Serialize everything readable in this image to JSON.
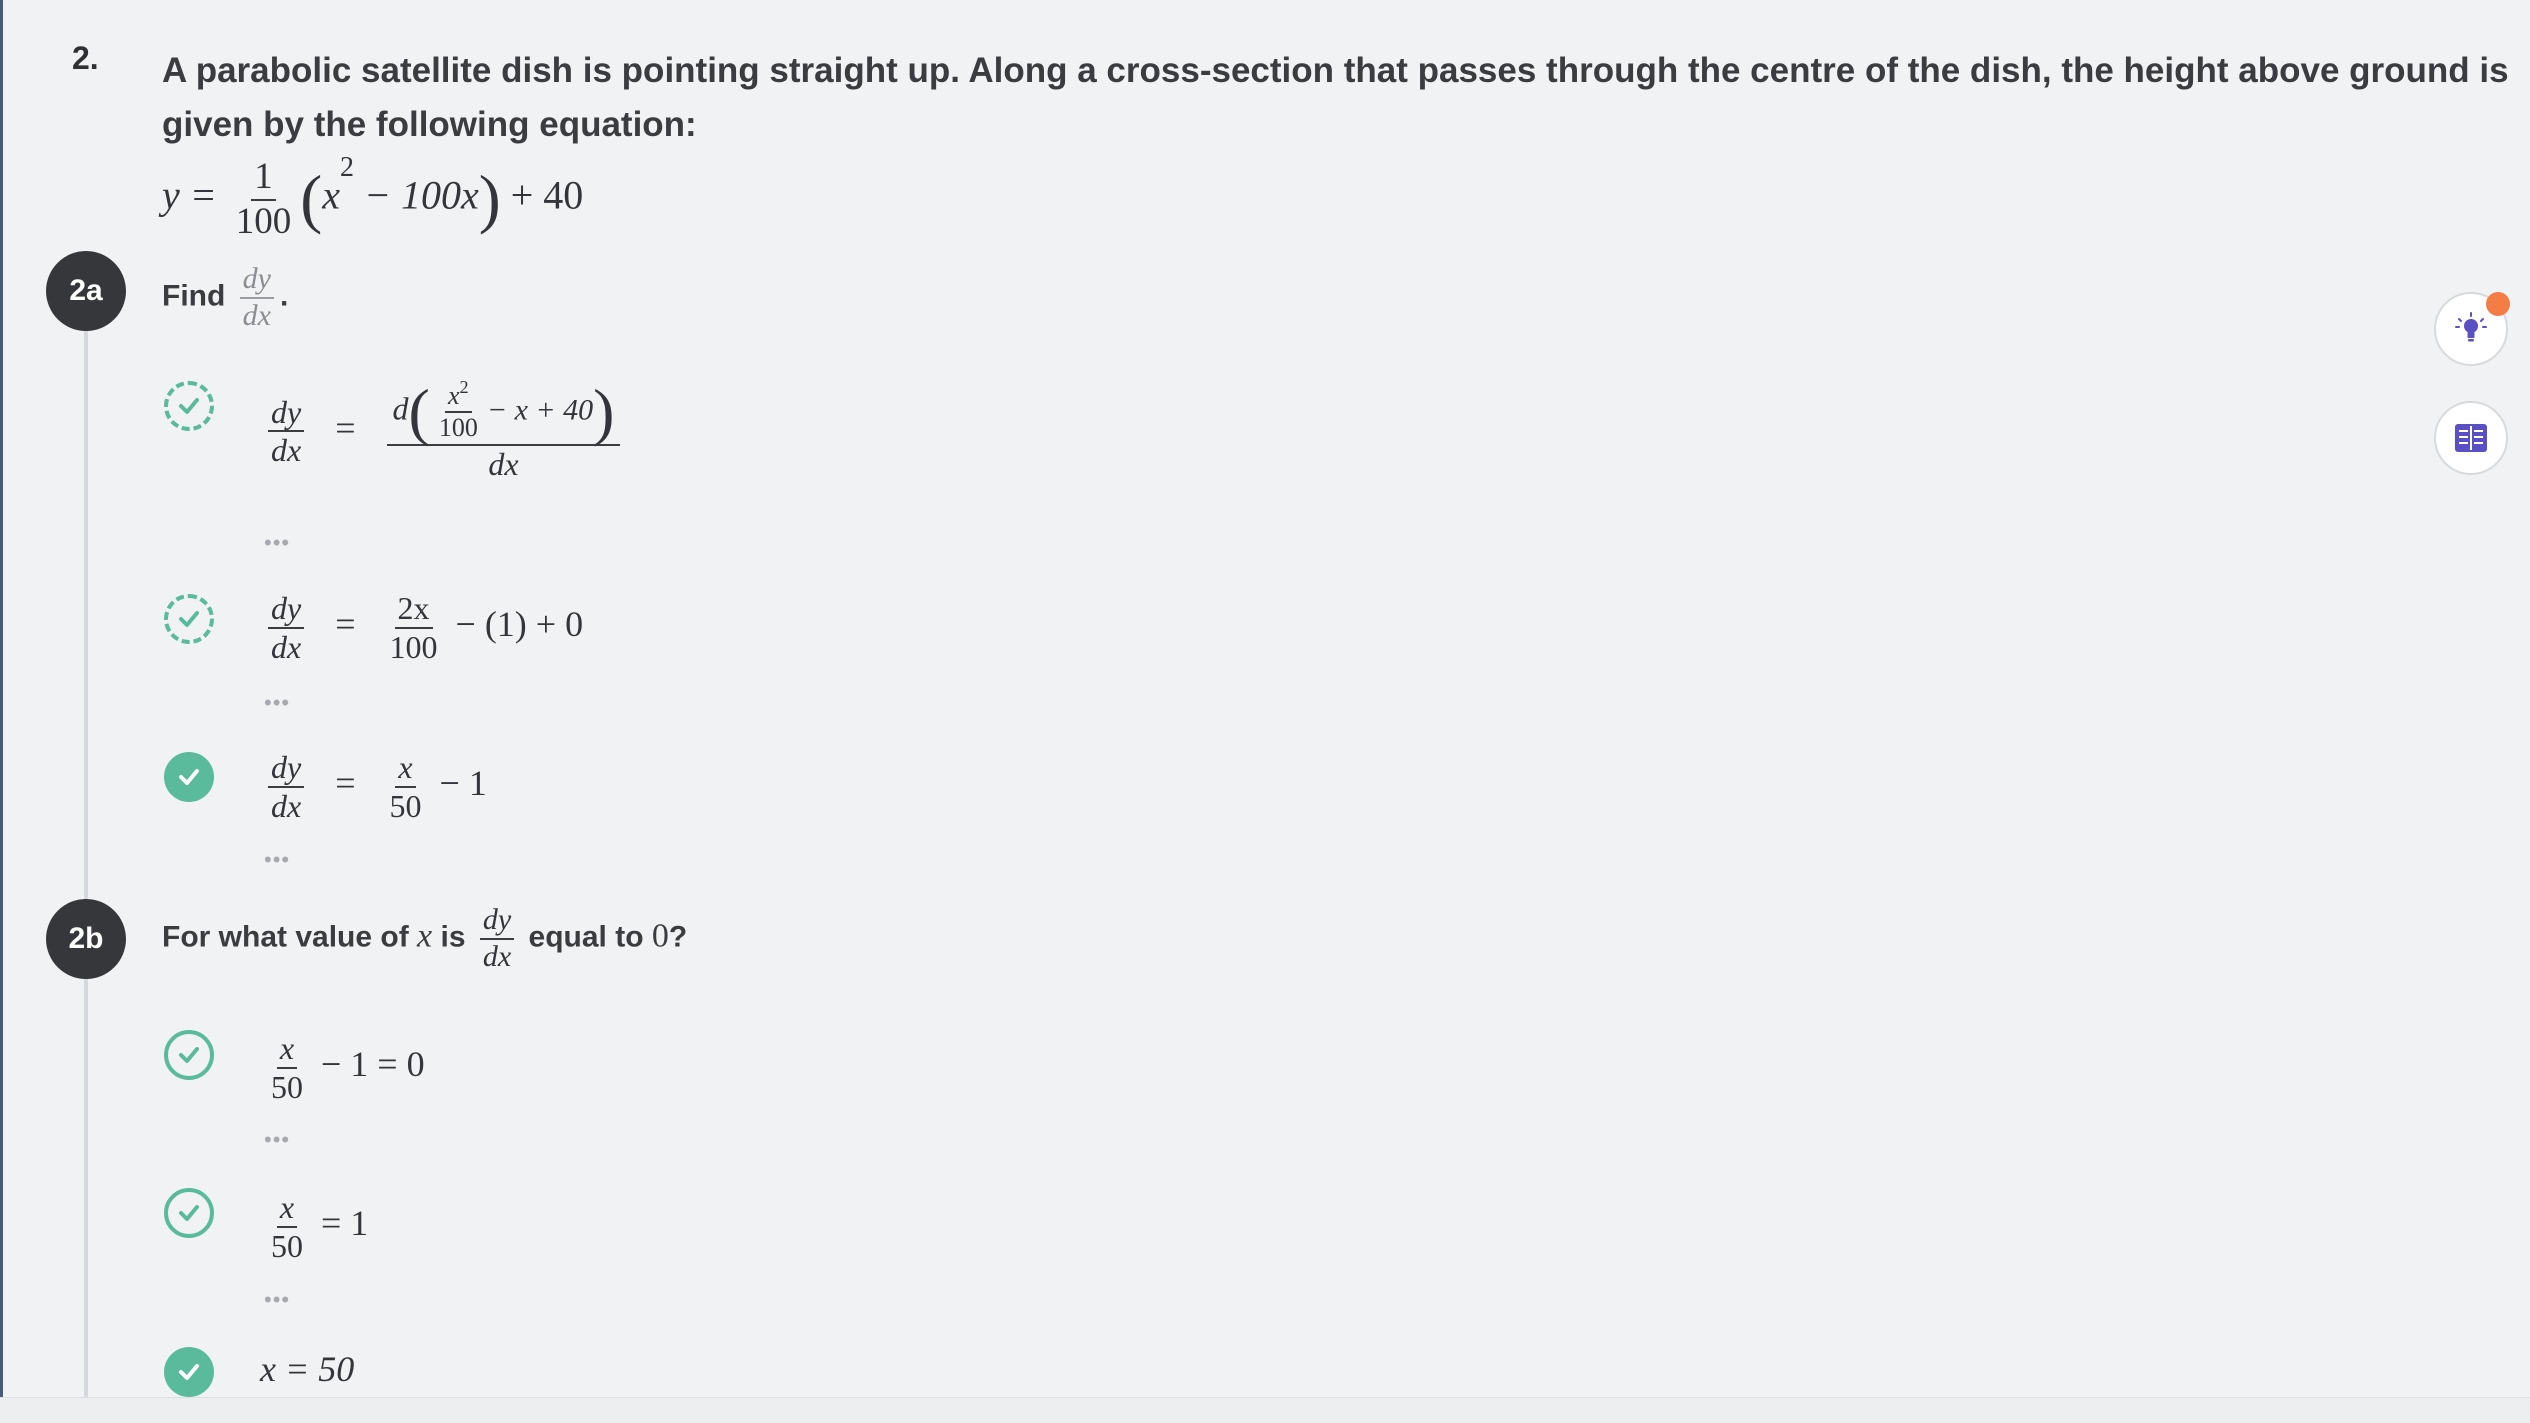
{
  "question": {
    "number": "2.",
    "intro": "A parabolic satellite dish is pointing straight up. Along a cross-section that passes through the centre of the dish, the height above ground is given by the following equation:",
    "equation": {
      "lhs": "y =",
      "frac_num": "1",
      "frac_den": "100",
      "x_var": "x",
      "exp": "2",
      "inner_rest": " − 100x",
      "tail": "+ 40"
    }
  },
  "part_a": {
    "badge": "2a",
    "prompt_text": "Find",
    "prompt_num": "dy",
    "prompt_den": "dx",
    "prompt_end": ".",
    "steps": [
      {
        "status": "dashed",
        "lhs_num": "dy",
        "lhs_den": "dx",
        "eq": "=",
        "d": "d",
        "inner_num": "x",
        "inner_exp": "2",
        "inner_den": "100",
        "inner_rest": "− x + 40",
        "rhs_den": "dx",
        "dots": "•••"
      },
      {
        "status": "dashed",
        "lhs_num": "dy",
        "lhs_den": "dx",
        "eq": "=",
        "rhs_num": "2x",
        "rhs_den": "100",
        "rhs_rest": "− (1) + 0",
        "dots": "•••"
      },
      {
        "status": "solid",
        "lhs_num": "dy",
        "lhs_den": "dx",
        "eq": "=",
        "rhs_num": "x",
        "rhs_den": "50",
        "rhs_rest": "− 1",
        "dots": "•••"
      }
    ]
  },
  "part_b": {
    "badge": "2b",
    "prompt_pre": "For what value of",
    "prompt_var": "x",
    "prompt_is": "is",
    "prompt_num": "dy",
    "prompt_den": "dx",
    "prompt_post": "equal to",
    "prompt_value": "0",
    "prompt_end": "?",
    "steps": [
      {
        "status": "outline",
        "num": "x",
        "den": "50",
        "rest": "− 1 = 0",
        "dots": "•••"
      },
      {
        "status": "outline",
        "num": "x",
        "den": "50",
        "rest": "= 1",
        "dots": "•••"
      },
      {
        "status": "solid",
        "text": "x = 50"
      }
    ]
  },
  "tools": {
    "hint_icon": "lightbulb-icon",
    "book_icon": "book-icon",
    "accent": "#5b4fc4",
    "notification_color": "#f47c45"
  },
  "colors": {
    "check": "#5aba9c",
    "badge": "#35373b",
    "background": "#f1f2f3"
  }
}
